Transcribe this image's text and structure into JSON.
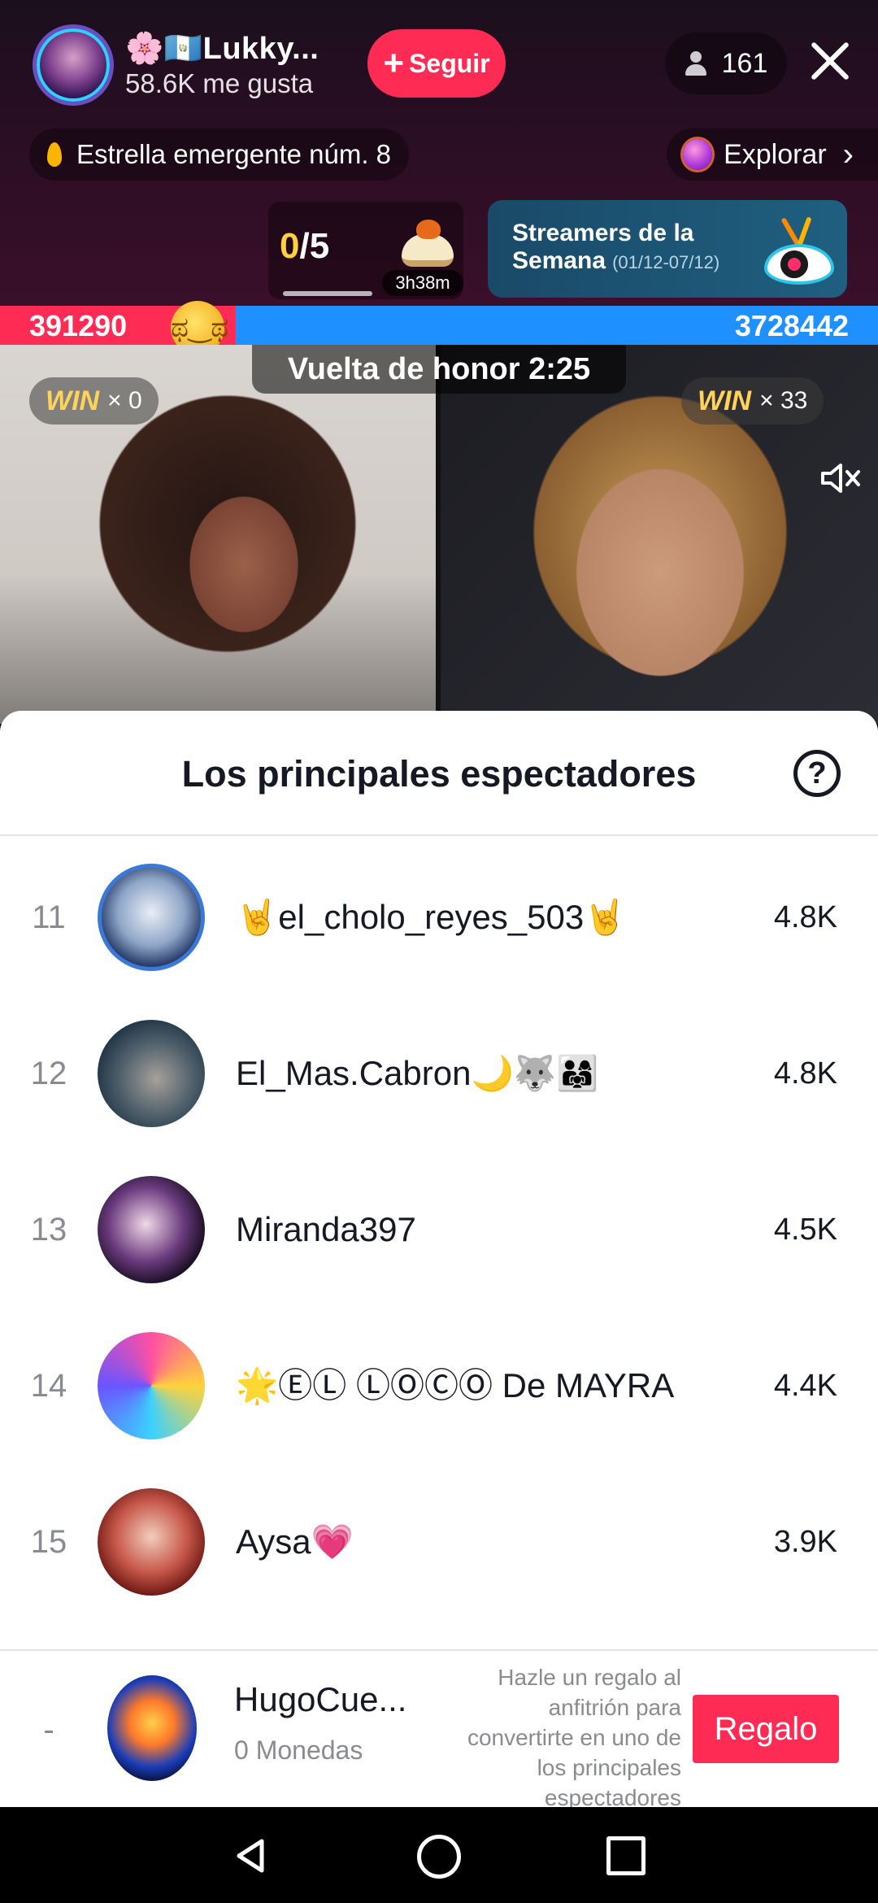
{
  "header": {
    "host_name": "🌸🇬🇹Lukky...",
    "host_likes": "58.6K me gusta",
    "follow_label": "Seguir",
    "viewer_count": "161",
    "rising_star": "Estrella emergente núm. 8",
    "explore_label": "Explorar"
  },
  "quest": {
    "done": "0",
    "total": "/5",
    "timer": "3h38m"
  },
  "streamers_card": {
    "title": "Streamers de la Semana",
    "dates": "(01/12-07/12)"
  },
  "battle": {
    "left_score": "391290",
    "right_score": "3728442",
    "honor_lap": "Vuelta de honor 2:25",
    "left_win_label": "WIN",
    "left_win_count": "× 0",
    "right_win_label": "WIN",
    "right_win_count": "× 33"
  },
  "sheet": {
    "title": "Los principales espectadores",
    "help_symbol": "?"
  },
  "viewers": [
    {
      "rank": "11",
      "name": "🤘el_cholo_reyes_503🤘",
      "score": "4.8K"
    },
    {
      "rank": "12",
      "name": "El_Mas.Cabron🌙🐺👨‍👩‍👧",
      "score": "4.8K"
    },
    {
      "rank": "13",
      "name": "Miranda397",
      "score": "4.5K"
    },
    {
      "rank": "14",
      "name": "🌟ⒺⓁ ⓁⓄⒸⓄ De MAYRA",
      "score": "4.4K"
    },
    {
      "rank": "15",
      "name": "Aysa💗",
      "score": "3.9K"
    }
  ],
  "me": {
    "rank": "-",
    "name": "HugoCue...",
    "coins": "0 Monedas",
    "hint": "Hazle un regalo al anfitrión para convertirte en uno de los principales espectadores",
    "gift_label": "Regalo"
  },
  "colors": {
    "accent": "#fe2c55",
    "battle_blue": "#1e90ff",
    "win_gold": "#ffd35a"
  }
}
